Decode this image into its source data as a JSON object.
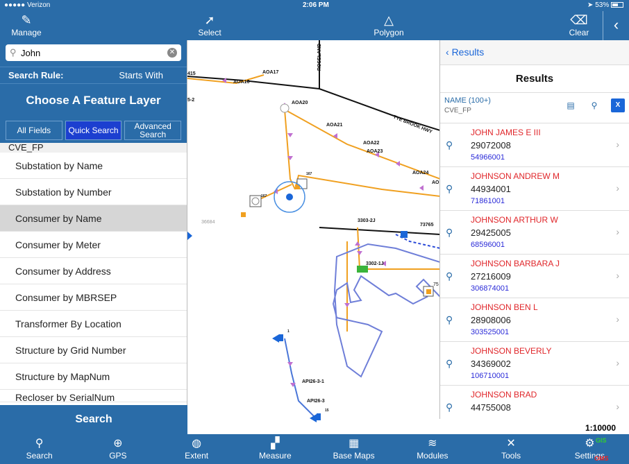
{
  "status": {
    "carrier": "●●●●● Verizon",
    "time": "2:06 PM",
    "battery": "53%"
  },
  "toolbar": {
    "manage": "Manage",
    "select": "Select",
    "polygon": "Polygon",
    "clear": "Clear"
  },
  "search": {
    "value": "John",
    "rule_label": "Search Rule:",
    "rule_value": "Starts With"
  },
  "layer_panel": {
    "title": "Choose A Feature Layer",
    "segments": [
      "All Fields",
      "Quick Search",
      "Advanced Search"
    ],
    "group": "CVE_FP",
    "items": [
      "Substation by Name",
      "Substation by Number",
      "Consumer by Name",
      "Consumer by Meter",
      "Consumer by Address",
      "Consumer by MBRSEP",
      "Transformer By Location",
      "Structure by Grid Number",
      "Structure by MapNum",
      "Recloser by SerialNum"
    ],
    "search_button": "Search"
  },
  "map": {
    "labels": [
      "AOA17",
      "AOA16",
      "AOA20",
      "AOA21",
      "AOA22",
      "AOA23",
      "AOA24",
      "AO",
      "ROSELAND",
      "TYE BROOK HWY",
      "3303-2J",
      "73765",
      "3302-1J",
      "API26-3-1",
      "API26-3",
      "36684",
      "167",
      "167",
      "1",
      "15",
      "5-2",
      "415",
      "75"
    ]
  },
  "results": {
    "back": "Results",
    "title": "Results",
    "layer_name": "NAME (100+)",
    "layer_sub": "CVE_FP",
    "rows": [
      {
        "name": "JOHN JAMES E III",
        "meter": "29072008",
        "acct": "54966001"
      },
      {
        "name": "JOHNSON ANDREW M",
        "meter": "44934001",
        "acct": "71861001"
      },
      {
        "name": "JOHNSON ARTHUR W",
        "meter": "29425005",
        "acct": "68596001"
      },
      {
        "name": "JOHNSON BARBARA J",
        "meter": "27216009",
        "acct": "306874001"
      },
      {
        "name": "JOHNSON BEN L",
        "meter": "28908006",
        "acct": "303525001"
      },
      {
        "name": "JOHNSON BEVERLY",
        "meter": "34369002",
        "acct": "106710001"
      },
      {
        "name": "JOHNSON BRAD",
        "meter": "44755008",
        "acct": ""
      }
    ]
  },
  "scale": "1:10000",
  "tabs": [
    "Search",
    "GPS",
    "Extent",
    "Measure",
    "Base Maps",
    "Modules",
    "Tools",
    "Settings"
  ],
  "indicators": {
    "gis": "GIS",
    "oms": "OMS"
  }
}
